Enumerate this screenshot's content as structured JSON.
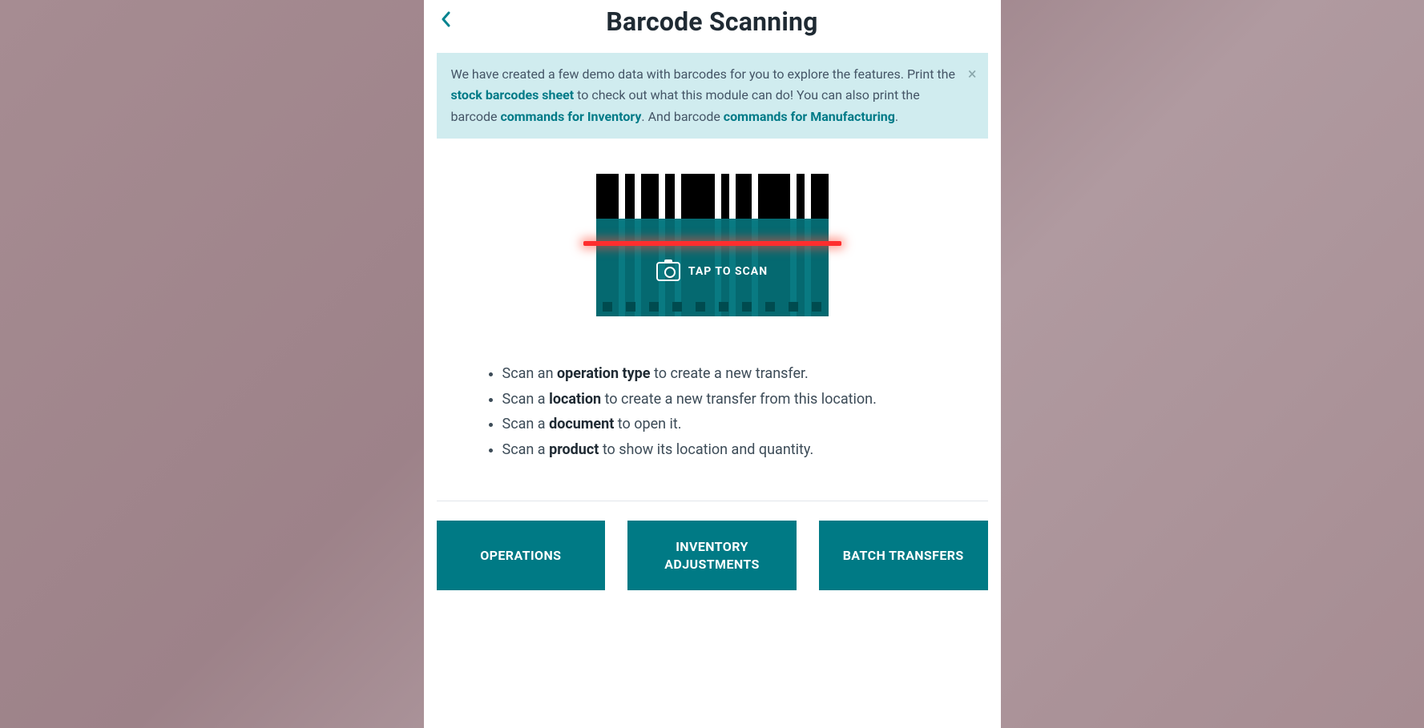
{
  "header": {
    "title": "Barcode Scanning"
  },
  "alert": {
    "text_before_link1": "We have created a few demo data with barcodes for you to explore the features. Print the ",
    "link1": "stock barcodes sheet",
    "text_between_1_2": " to check out what this module can do! You can also print the barcode ",
    "link2": "commands for Inventory",
    "text_between_2_3": ". And barcode ",
    "link3": "commands for Manufacturing",
    "text_after": ".",
    "close_glyph": "×"
  },
  "scanner": {
    "tap_label": "TAP TO SCAN"
  },
  "hints": [
    {
      "pre": "Scan an ",
      "bold": "operation type",
      "post": " to create a new transfer."
    },
    {
      "pre": "Scan a ",
      "bold": "location",
      "post": " to create a new transfer from this location."
    },
    {
      "pre": "Scan a ",
      "bold": "document",
      "post": " to open it."
    },
    {
      "pre": "Scan a ",
      "bold": "product",
      "post": " to show its location and quantity."
    }
  ],
  "buttons": {
    "operations": "OPERATIONS",
    "inventory": "INVENTORY ADJUSTMENTS",
    "batch": "BATCH TRANSFERS"
  }
}
